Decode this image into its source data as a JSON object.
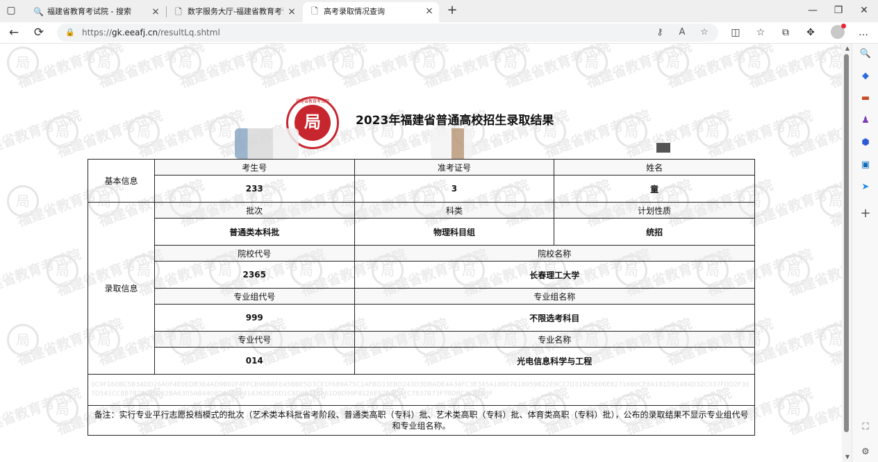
{
  "browser": {
    "tabs": [
      {
        "label": "福建省教育考试院 - 搜索",
        "icon": "search-icon",
        "close": "×"
      },
      {
        "label": "数字服务大厅-福建省教育考试院",
        "icon": "page-icon",
        "close": "×"
      },
      {
        "label": "高考录取情况查询",
        "icon": "page-icon",
        "close": "×"
      }
    ],
    "new_tab": "+",
    "url_prefix": "https://",
    "url_host": "gk.eeafj.cn",
    "url_path": "/resultLq.shtml",
    "window_controls": {
      "minimize": "—",
      "restore": "❐",
      "close": "✕"
    },
    "nav": {
      "back": "←",
      "reload": "⟳"
    }
  },
  "page": {
    "title": "2023年福建省普通高校招生录取结果",
    "logo_glyph": "局",
    "logo_ring": "福建省教育考试院",
    "table": {
      "basic_section": "基本信息",
      "exam_no_label": "考生号",
      "exam_no_value": "233",
      "ticket_label": "准考证号",
      "ticket_value": "3",
      "name_label": "姓名",
      "name_value": "童",
      "admission_section": "录取信息",
      "batch_label": "批次",
      "batch_value": "普通类本科批",
      "category_label": "科类",
      "category_value": "物理科目组",
      "plan_label": "计划性质",
      "plan_value": "统招",
      "school_code_label": "院校代号",
      "school_code_value": "2365",
      "school_name_label": "院校名称",
      "school_name_value": "长春理工大学",
      "group_code_label": "专业组代号",
      "group_code_value": "999",
      "group_name_label": "专业组名称",
      "group_name_value": "不限选考科目",
      "major_code_label": "专业代号",
      "major_code_value": "014",
      "major_name_label": "专业名称",
      "major_name_value": "光电信息科学与工程",
      "hash_text": "0C9F160BC5B34DD26A0F4E0EDB3E4AD9B02F4FFCB96BBFE45BBE5D3CE1F689A75C1AFBD33EBD243D3DBADE4A34FC3E345A18907618959B22E9C27D31925E06E8271680CE8A181D91484D32C037FDD2F307D541CC8B7828696C82BA6305AB4408D68A68414362E20D1C8D8011EA61D8D99F8126E97D9CA7C7837B73F7BDBCAC8E63F",
      "note": "备注：实行专业平行志愿投档模式的批次（艺术类本科批省考阶段、普通类高职（专科）批、艺术类高职（专科）批、体育类高职（专科）批），公布的录取结果不显示专业组代号和专业组名称。"
    },
    "watermark_text": "福建省教育考试院"
  },
  "colors": {
    "accent": "#c8262e",
    "tabbar": "#efefef",
    "border": "#222222"
  }
}
